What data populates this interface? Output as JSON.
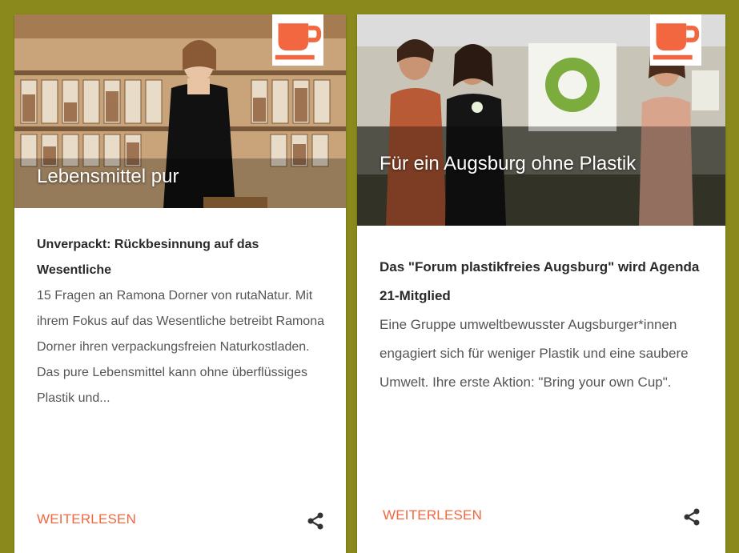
{
  "cards": [
    {
      "hero_title": "Lebensmittel pur",
      "headline": "Unverpackt: Rückbesinnung auf das Wesentliche",
      "teaser": "15 Fragen an Ramona Dorner von rutaNatur. Mit ihrem Fokus auf das Wesentliche betreibt Ramona Dorner ihren verpackungsfreien Naturkostladen. Das pure Lebensmittel kann ohne überflüssiges Plastik und...",
      "read_more": "WEITERLESEN",
      "category_icon": "coffee-cup-icon",
      "share_icon": "share-icon"
    },
    {
      "hero_title": "Für ein Augsburg ohne Plastik",
      "headline": "Das \"Forum plastikfreies Augsburg\" wird Agenda 21-Mitglied",
      "teaser": "Eine Gruppe umweltbewusster Augsburger*innen engagiert sich für weniger Plastik und eine saubere Umwelt. Ihre erste Aktion: \"Bring your own Cup\".",
      "read_more": "WEITERLESEN",
      "category_icon": "coffee-cup-icon",
      "share_icon": "share-icon"
    }
  ],
  "colors": {
    "page_background": "#8a8a1c",
    "accent": "#f2673f",
    "headline_text": "#2a2a2a",
    "body_text": "#555555"
  }
}
